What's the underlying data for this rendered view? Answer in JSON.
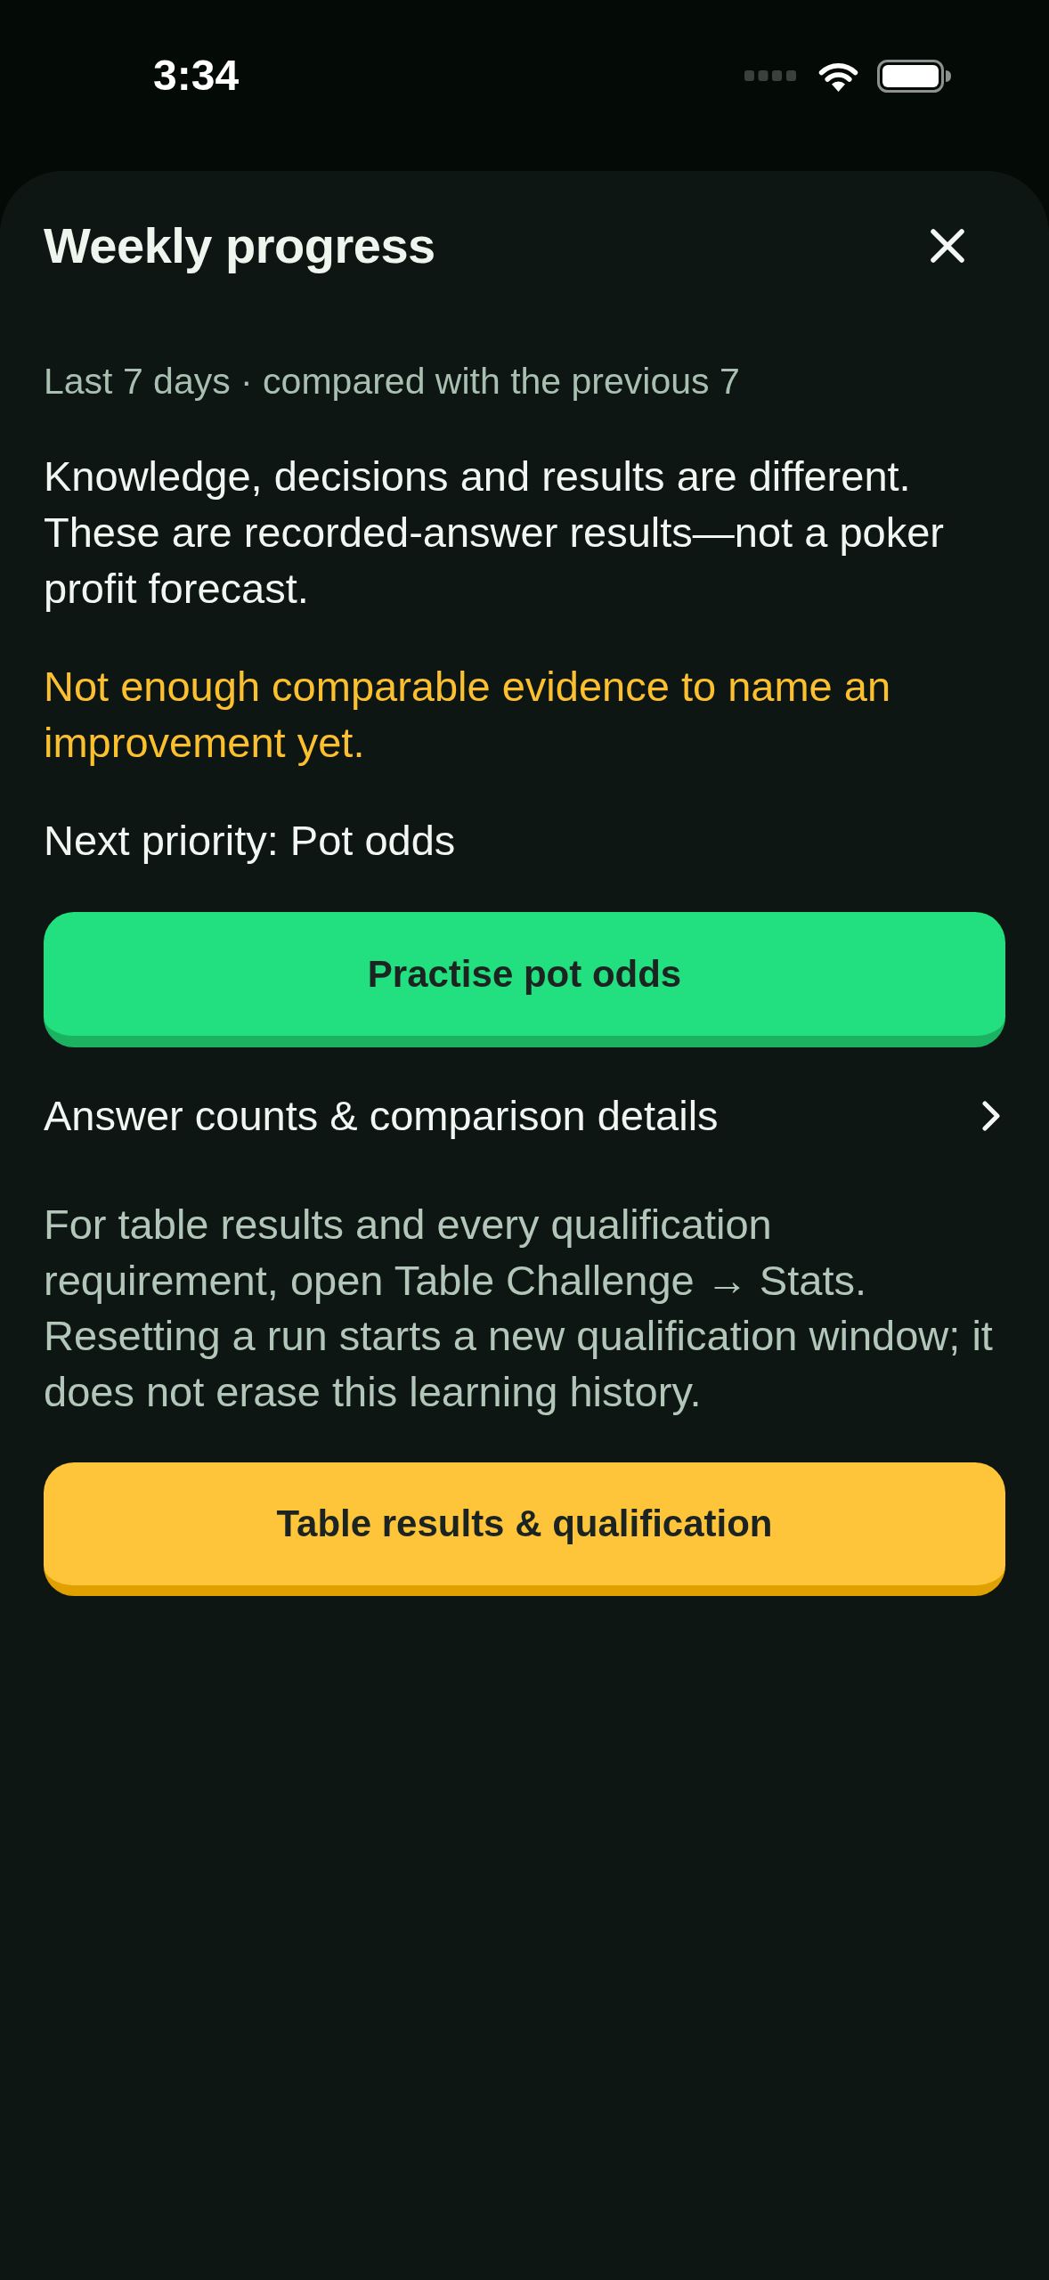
{
  "status_bar": {
    "time": "3:34"
  },
  "sheet": {
    "title": "Weekly progress",
    "subtitle": "Last 7 days · compared with the previous 7",
    "disclaimer": "Knowledge, decisions and results are different. These are recorded-answer results—not a poker profit forecast.",
    "notice": "Not enough comparable evidence to name an improvement yet.",
    "next_priority": "Next priority: Pot odds",
    "primary_button": "Practise pot odds",
    "details_link": "Answer counts & comparison details",
    "info": [
      "For table results and every qualification requirement, open Table Challenge → Stats.",
      "Resetting a run starts a new qualification window; it does not erase this learning history."
    ],
    "secondary_button": "Table results & qualification"
  }
}
